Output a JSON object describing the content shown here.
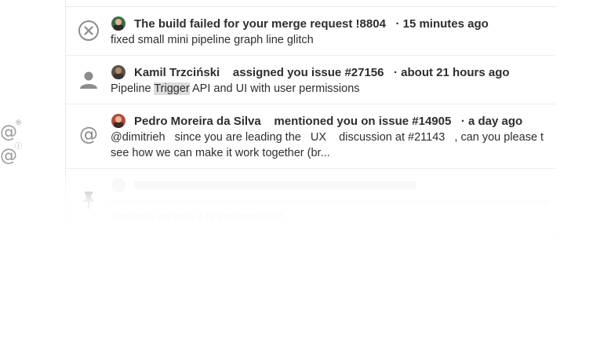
{
  "notifications": [
    {
      "icon": "x-circle-icon",
      "title": "The build failed for your merge request !8804",
      "time": "· 15 minutes ago",
      "body": "fixed small mini pipeline graph line glitch"
    },
    {
      "icon": "person-icon",
      "author": "Kamil Trzciński",
      "action": "assigned you issue #27156",
      "time": "· about 21 hours ago",
      "body_before": "Pipeline ",
      "body_highlight": "Trigger",
      "body_after": " API and UI with user permissions"
    },
    {
      "icon": "at-sign-icon",
      "author": "Pedro Moreira da Silva",
      "action": "mentioned you on issue #14905",
      "time": "· a day ago",
      "body_line1": "@dimitrieh   since you are leading the   UX    discussion at #21143   , can you please t",
      "body_line2": "see how we can make it work together (br..."
    },
    {
      "icon": "pin-icon",
      "body_line3": "depends on how it is implemented..."
    }
  ]
}
